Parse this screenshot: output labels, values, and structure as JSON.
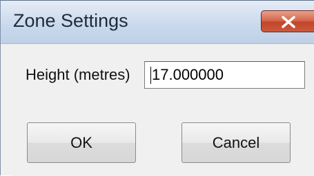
{
  "window": {
    "title": "Zone Settings",
    "close_icon": "close-icon",
    "close_color": "#c7472c",
    "titlebar_color": "#c9d8ec"
  },
  "form": {
    "height_label": "Height (metres)",
    "height_value": "17.000000"
  },
  "buttons": {
    "ok_label": "OK",
    "cancel_label": "Cancel"
  }
}
